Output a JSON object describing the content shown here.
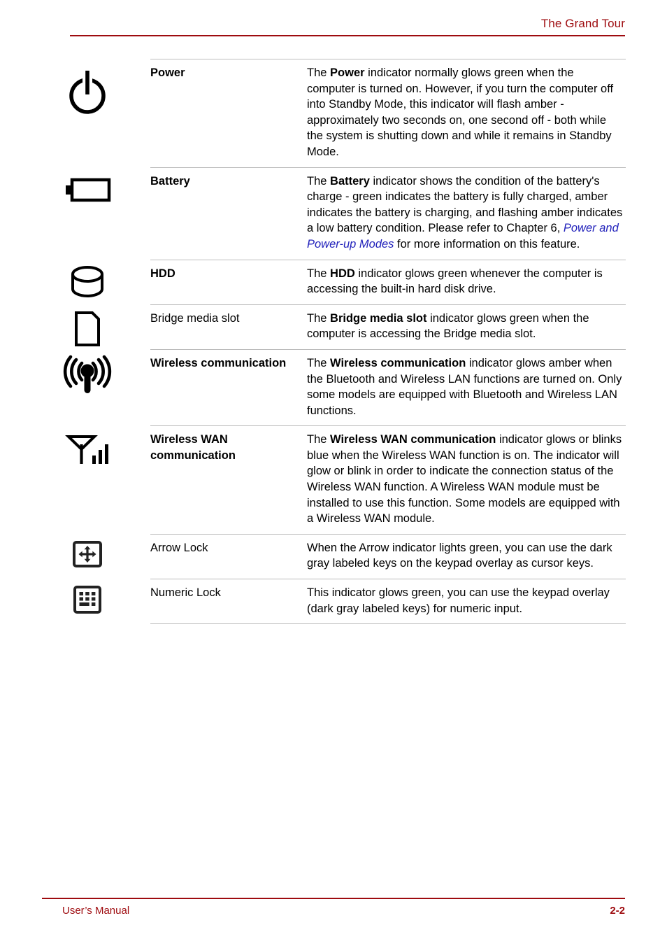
{
  "header": {
    "title": "The Grand Tour",
    "accent_color": "#9e0b0f"
  },
  "footer": {
    "left_label": "User’s Manual",
    "page_number": "2-2",
    "accent_color": "#9e0b0f"
  },
  "table": {
    "link_color": "#2222bb",
    "rule_color": "#bcbcbc",
    "rows": [
      {
        "icon": "power-icon",
        "name": "Power",
        "name_bold": true,
        "desc_pre": "The ",
        "desc_bold": "Power",
        "desc_post": " indicator normally glows green when the computer is turned on. However, if you turn the computer off into Standby Mode, this indicator will flash amber - approximately two seconds on, one second off - both while the system is shutting down and while it remains in Standby Mode."
      },
      {
        "icon": "battery-icon",
        "name": "Battery",
        "name_bold": true,
        "desc_pre": "The ",
        "desc_bold": "Battery",
        "desc_post": " indicator shows the condition of the battery's charge - green indicates the battery is fully charged, amber indicates the battery is charging, and flashing amber indicates a low battery condition. Please refer to Chapter 6, ",
        "desc_link": "Power and Power-up Modes",
        "desc_tail": " for more information on this feature."
      },
      {
        "icon": "hdd-icon",
        "name": "HDD",
        "name_bold": true,
        "desc_pre": "The ",
        "desc_bold": "HDD",
        "desc_post": " indicator glows green whenever the computer is accessing the built-in hard disk drive."
      },
      {
        "icon": "bridge-media-slot-icon",
        "name": "Bridge media slot",
        "name_bold": false,
        "desc_pre": "The ",
        "desc_bold": "Bridge media slot",
        "desc_post": " indicator glows green when the computer is accessing the Bridge media slot."
      },
      {
        "icon": "wireless-communication-icon",
        "name": "Wireless communication",
        "name_bold": true,
        "desc_pre": "The ",
        "desc_bold": "Wireless communication",
        "desc_post": " indicator glows amber when the Bluetooth and Wireless LAN functions are turned on. Only some models are equipped with Bluetooth and Wireless LAN functions."
      },
      {
        "icon": "wireless-wan-icon",
        "name": "Wireless WAN communication",
        "name_bold": true,
        "desc_pre": "The ",
        "desc_bold": "Wireless WAN communication",
        "desc_post": " indicator glows or blinks blue when the Wireless WAN function is on. The indicator will glow or blink in order to indicate the connection status of the Wireless WAN function. A Wireless WAN module must be installed to use this function. Some models are equipped with a Wireless WAN module."
      },
      {
        "icon": "arrow-lock-icon",
        "name": "Arrow Lock",
        "name_bold": false,
        "desc_pre": "",
        "desc_bold": "",
        "desc_post": "When the Arrow indicator lights green, you can use the dark gray labeled keys on the keypad overlay as cursor keys."
      },
      {
        "icon": "numeric-lock-icon",
        "name": "Numeric Lock",
        "name_bold": false,
        "desc_pre": "",
        "desc_bold": "",
        "desc_post": "This indicator glows green, you can use the keypad overlay (dark gray labeled keys) for numeric input."
      }
    ]
  }
}
